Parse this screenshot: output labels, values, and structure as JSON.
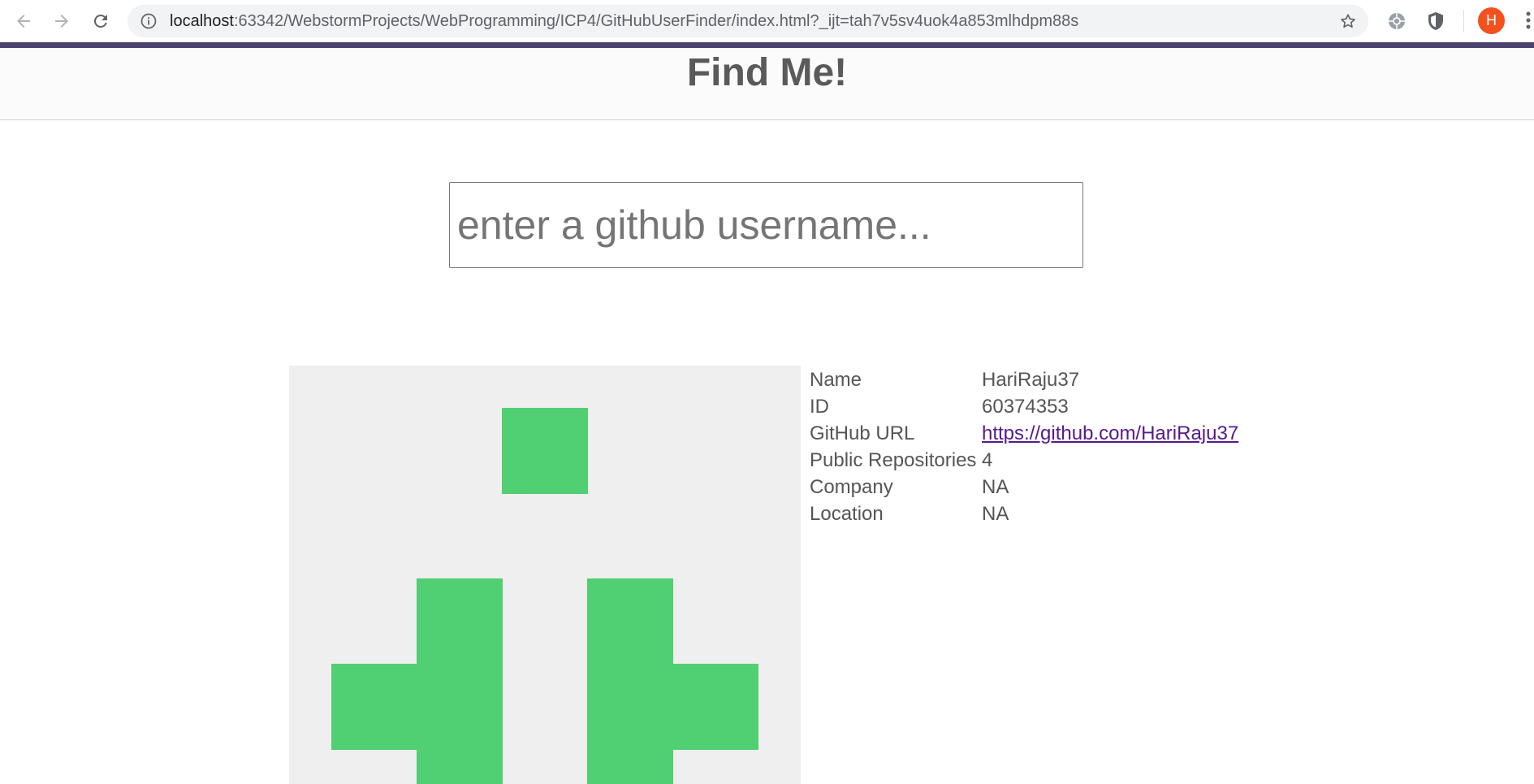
{
  "browser": {
    "url_host": "localhost",
    "url_rest": ":63342/WebstormProjects/WebProgramming/ICP4/GitHubUserFinder/index.html?_ijt=tah7v5sv4uok4a853mlhdpm88s",
    "profile_initial": "H",
    "profile_color": "#f4511e",
    "theme_bar_color": "#4c4270",
    "icons": [
      "back-arrow-icon",
      "forward-arrow-icon",
      "reload-icon",
      "info-icon",
      "bookmark-star-icon",
      "extension-icon",
      "shield-icon",
      "more-menu-icon"
    ]
  },
  "header": {
    "title": "Find Me!"
  },
  "search": {
    "placeholder": "enter a github username...",
    "value": ""
  },
  "avatar": {
    "background_color": "#efefef",
    "pattern_color": "#51cf73"
  },
  "profile": {
    "rows": [
      {
        "label": "Name",
        "value": "HariRaju37"
      },
      {
        "label": "ID",
        "value": "60374353"
      },
      {
        "label": "GitHub URL",
        "value": "https://github.com/HariRaju37",
        "is_link": true
      },
      {
        "label": "Public Repositories",
        "value": "4"
      },
      {
        "label": "Company",
        "value": "NA"
      },
      {
        "label": "Location",
        "value": "NA"
      }
    ]
  }
}
